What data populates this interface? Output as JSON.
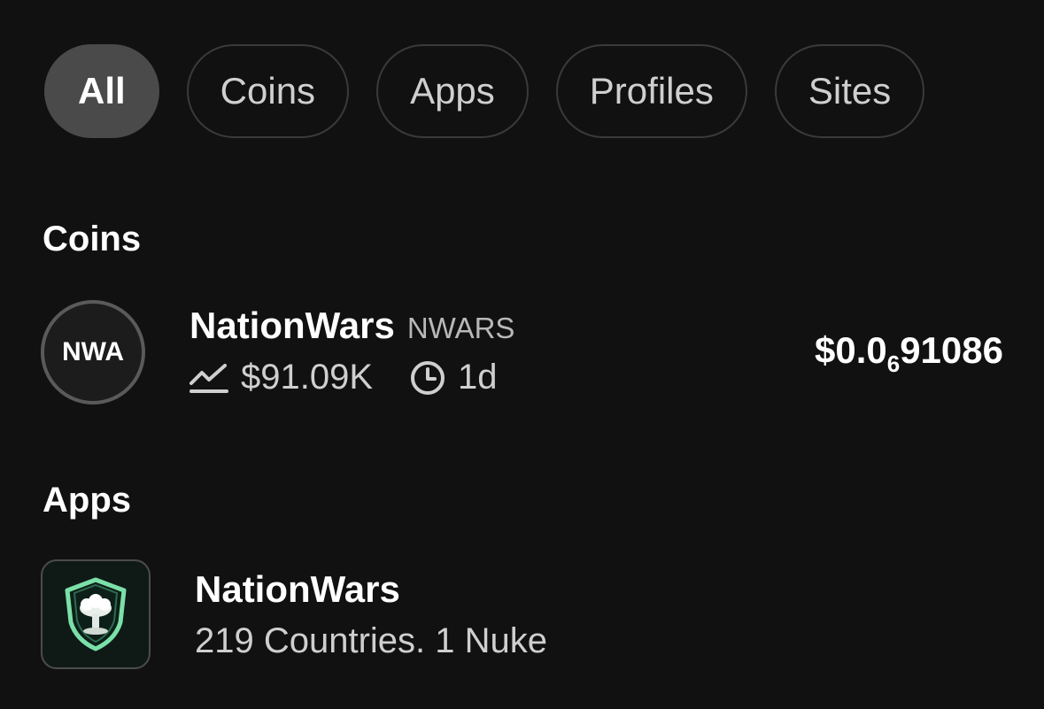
{
  "filters": {
    "items": [
      {
        "label": "All",
        "active": true
      },
      {
        "label": "Coins",
        "active": false
      },
      {
        "label": "Apps",
        "active": false
      },
      {
        "label": "Profiles",
        "active": false
      },
      {
        "label": "Sites",
        "active": false
      }
    ]
  },
  "sections": {
    "coins_title": "Coins",
    "apps_title": "Apps"
  },
  "coin": {
    "avatar_text": "NWA",
    "name": "NationWars",
    "ticker": "NWARS",
    "market_cap": "$91.09K",
    "age": "1d",
    "price_prefix": "$0.0",
    "price_zeros_subscript": "6",
    "price_digits": "91086",
    "icons": {
      "market_cap": "trend-line-icon",
      "age": "clock-icon"
    }
  },
  "app": {
    "name": "NationWars",
    "description": "219 Countries. 1 Nuke",
    "icon": "nuke-shield-logo"
  },
  "colors": {
    "background": "#111111",
    "chip_active": "#4a4a4a",
    "chip_border": "#3a3a3a",
    "logo_green": "#7be0a8"
  }
}
